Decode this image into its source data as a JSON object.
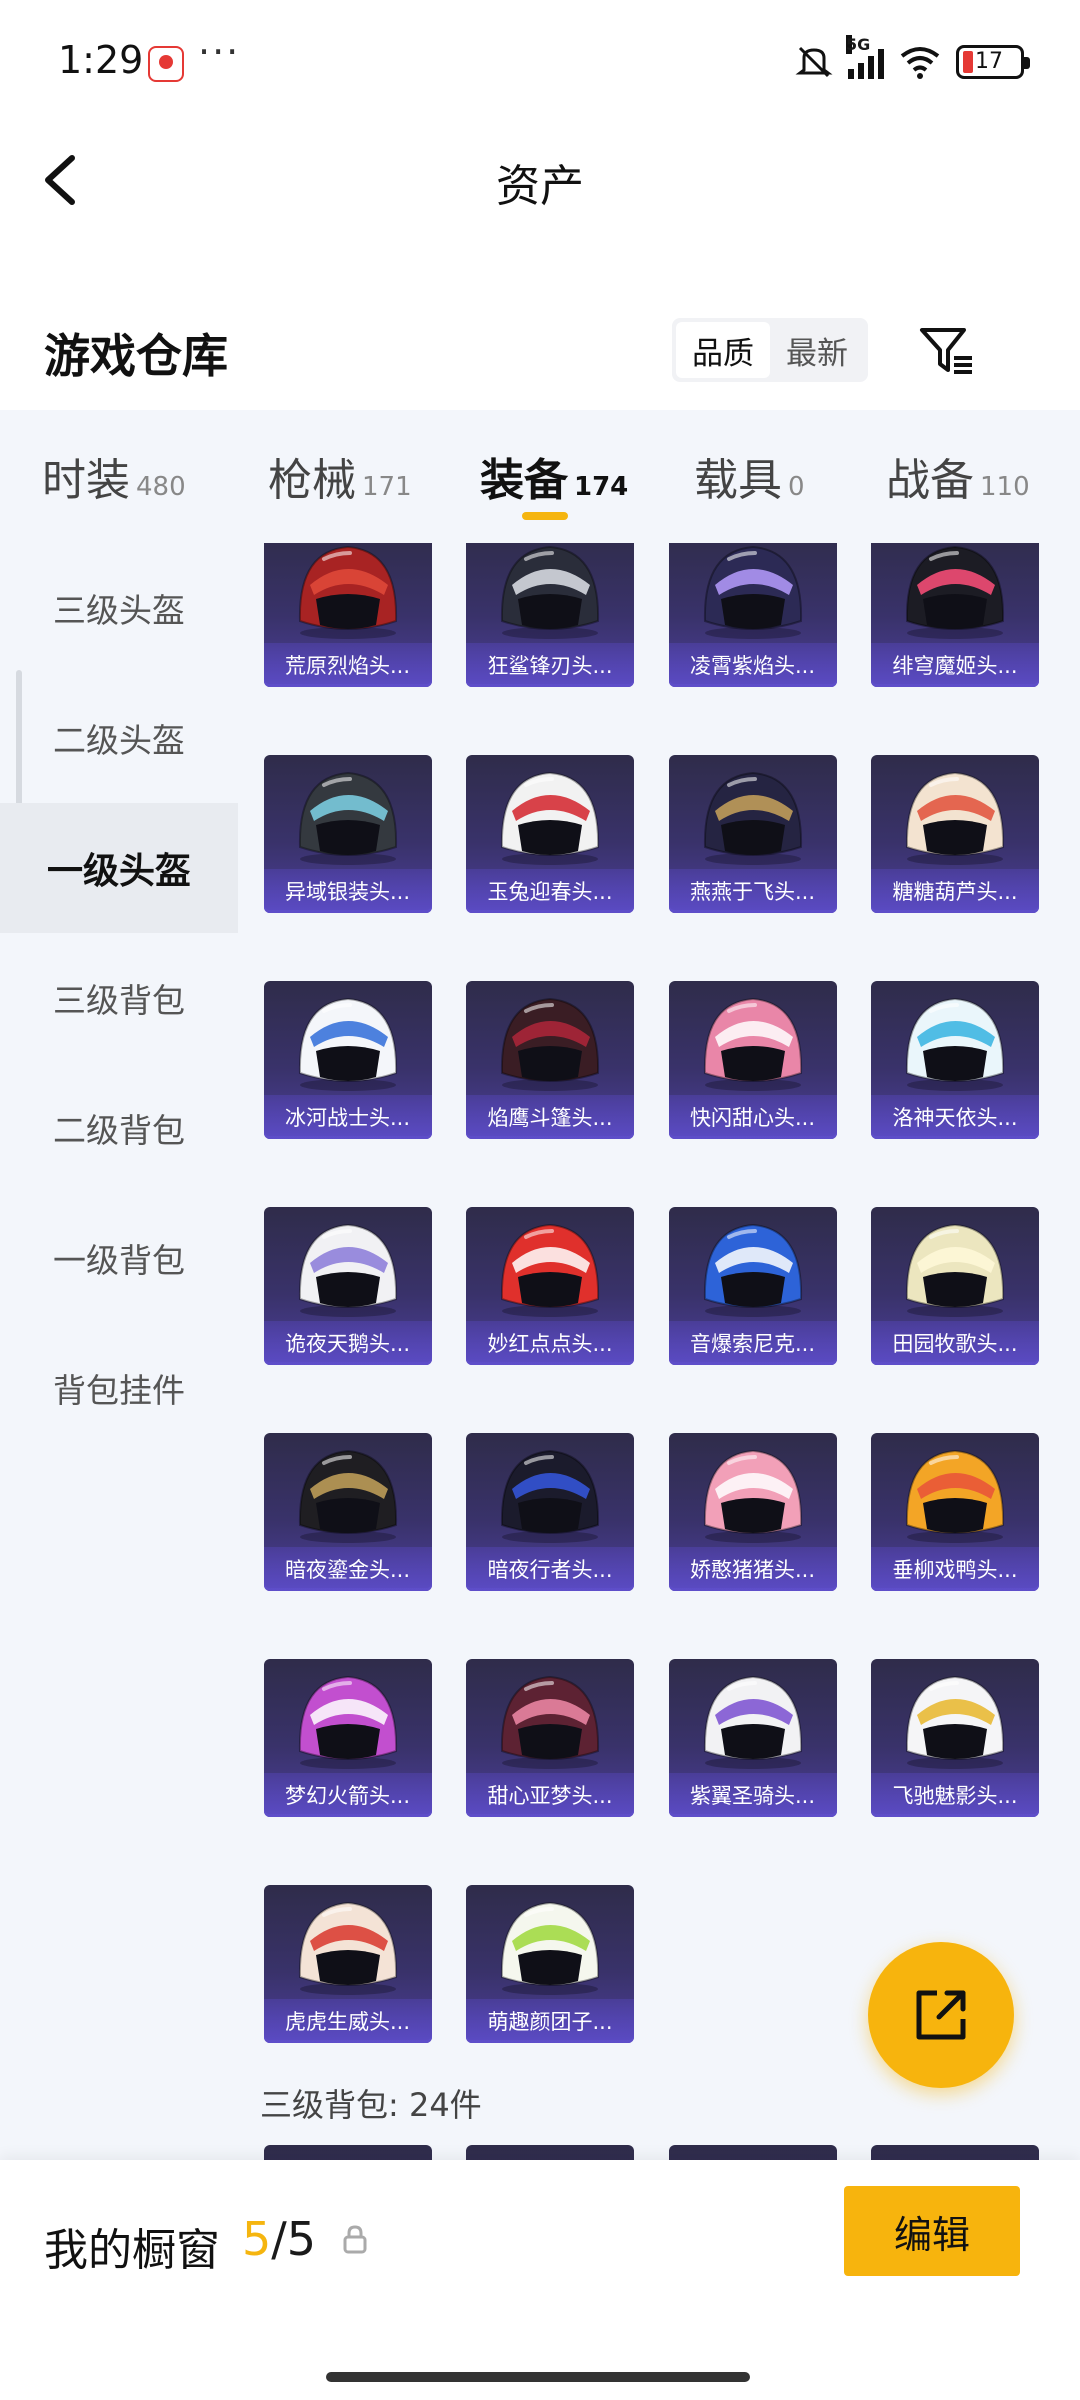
{
  "status_bar": {
    "time": "1:29",
    "battery": "17",
    "network": "5G"
  },
  "header": {
    "title": "资产",
    "back_icon": "chevron-left-icon"
  },
  "warehouse": {
    "title": "游戏仓库",
    "sort_options": [
      {
        "label": "品质",
        "active": true
      },
      {
        "label": "最新",
        "active": false
      }
    ],
    "filter_icon": "filter-icon"
  },
  "tabs": [
    {
      "label": "时装",
      "count": "480"
    },
    {
      "label": "枪械",
      "count": "171"
    },
    {
      "label": "装备",
      "count": "174",
      "active": true
    },
    {
      "label": "载具",
      "count": "0"
    },
    {
      "label": "战备",
      "count": "110"
    }
  ],
  "sidebar": [
    {
      "label": "三级头盔"
    },
    {
      "label": "二级头盔"
    },
    {
      "label": "一级头盔",
      "active": true
    },
    {
      "label": "三级背包"
    },
    {
      "label": "二级背包"
    },
    {
      "label": "一级背包"
    },
    {
      "label": "背包挂件"
    }
  ],
  "items": [
    {
      "name": "荒原烈焰头...",
      "base": "#a82323",
      "accent": "#e24a3a"
    },
    {
      "name": "狂鲨锋刃头...",
      "base": "#2a2d3a",
      "accent": "#dfe3ea"
    },
    {
      "name": "凌霄紫焰头...",
      "base": "#2c2a55",
      "accent": "#b69cff"
    },
    {
      "name": "绯穹魔姬头...",
      "base": "#1c1c24",
      "accent": "#ff4f7a"
    },
    {
      "name": "异域银装头...",
      "base": "#34393f",
      "accent": "#7fd3e8"
    },
    {
      "name": "玉兔迎春头...",
      "base": "#f2f2f2",
      "accent": "#d4232c"
    },
    {
      "name": "燕燕于飞头...",
      "base": "#252442",
      "accent": "#c9a35a"
    },
    {
      "name": "糖糖葫芦头...",
      "base": "#f3e3d0",
      "accent": "#e0503a"
    },
    {
      "name": "冰河战士头...",
      "base": "#f4f6fa",
      "accent": "#2f6cd8"
    },
    {
      "name": "焰鹰斗篷头...",
      "base": "#3a1d24",
      "accent": "#b0263a"
    },
    {
      "name": "快闪甜心头...",
      "base": "#e986a8",
      "accent": "#ffffff"
    },
    {
      "name": "洛神天依头...",
      "base": "#eaf6fb",
      "accent": "#35b3e0"
    },
    {
      "name": "诡夜天鹅头...",
      "base": "#f1f1f4",
      "accent": "#8a7ad8"
    },
    {
      "name": "妙红点点头...",
      "base": "#e0302c",
      "accent": "#ffffff"
    },
    {
      "name": "音爆索尼克...",
      "base": "#2d63d8",
      "accent": "#ffffff"
    },
    {
      "name": "田园牧歌头...",
      "base": "#ece6bf",
      "accent": "#fff8d8"
    },
    {
      "name": "暗夜鎏金头...",
      "base": "#1f1e22",
      "accent": "#c6a35a"
    },
    {
      "name": "暗夜行者头...",
      "base": "#1b1b2c",
      "accent": "#3557e0"
    },
    {
      "name": "娇憨猪猪头...",
      "base": "#f2a0b8",
      "accent": "#ffffff"
    },
    {
      "name": "垂柳戏鸭头...",
      "base": "#f3a526",
      "accent": "#e8513a"
    },
    {
      "name": "梦幻火箭头...",
      "base": "#c24fcf",
      "accent": "#ffffff"
    },
    {
      "name": "甜心亚梦头...",
      "base": "#5d2233",
      "accent": "#f08aa8"
    },
    {
      "name": "紫翼圣骑头...",
      "base": "#f2f2f4",
      "accent": "#7a4fd0"
    },
    {
      "name": "飞驰魅影头...",
      "base": "#f5f5f7",
      "accent": "#e7b62a"
    },
    {
      "name": "虎虎生威头...",
      "base": "#f4e3d6",
      "accent": "#d8362c"
    },
    {
      "name": "萌趣颜团子...",
      "base": "#f5f7ee",
      "accent": "#9ed83a"
    }
  ],
  "next_section": {
    "label": "三级背包: 24件"
  },
  "fab": {
    "icon": "share-out-icon"
  },
  "bottom_bar": {
    "showcase_label": "我的橱窗",
    "showcase_current": "5",
    "showcase_separator": "/",
    "showcase_total": "5",
    "edit_label": "编辑"
  }
}
